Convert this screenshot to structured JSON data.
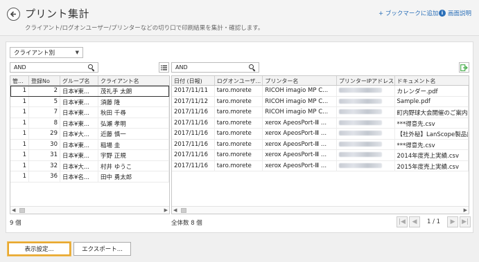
{
  "header": {
    "title": "プリント集計",
    "subtitle": "クライアント/ログオンユーザー/プリンターなどの切り口で印刷結果を集計・確認します。",
    "bookmark_label": "+ ブックマークに追加",
    "help_label": "画面説明"
  },
  "filter": {
    "selected": "クライアント別"
  },
  "left_search": {
    "value": "AND"
  },
  "right_search": {
    "value": "AND"
  },
  "left_table": {
    "columns": [
      "管...",
      "登録No",
      "グループ名",
      "クライアント名"
    ],
    "rows": [
      [
        "1",
        "2",
        "日本¥東...",
        "茂礼手 太朗"
      ],
      [
        "1",
        "5",
        "日本¥東...",
        "須藤 隆"
      ],
      [
        "1",
        "7",
        "日本¥東...",
        "秋田 千尋"
      ],
      [
        "1",
        "8",
        "日本¥東...",
        "弘瀬 孝明"
      ],
      [
        "1",
        "29",
        "日本¥大...",
        "近藤 慎一"
      ],
      [
        "1",
        "30",
        "日本¥東...",
        "稲場 圭"
      ],
      [
        "1",
        "31",
        "日本¥東...",
        "宇野 正規"
      ],
      [
        "1",
        "32",
        "日本¥大...",
        "村井 ゆうこ"
      ],
      [
        "1",
        "36",
        "日本¥名...",
        "田中 勇太郎"
      ]
    ],
    "count": "9 個"
  },
  "right_table": {
    "columns": [
      "日付 (日報)",
      "ログオンユーザ...",
      "プリンター名",
      "プリンターIPアドレス",
      "ドキュメント名"
    ],
    "rows": [
      [
        "2017/11/11",
        "taro.morete",
        "RICOH imagio MP C...",
        "",
        "カレンダー.pdf"
      ],
      [
        "2017/11/12",
        "taro.morete",
        "RICOH imagio MP C...",
        "",
        "Sample.pdf"
      ],
      [
        "2017/11/16",
        "taro.morete",
        "RICOH imagio MP C...",
        "",
        "町内野球大会開催のご案内"
      ],
      [
        "2017/11/16",
        "taro.morete",
        "xerox ApeosPort-Ⅲ ...",
        "",
        "***得意先.csv"
      ],
      [
        "2017/11/16",
        "taro.morete",
        "xerox ApeosPort-Ⅲ ...",
        "",
        "【社外秘】LanScope製品設"
      ],
      [
        "2017/11/16",
        "taro.morete",
        "xerox ApeosPort-Ⅲ ...",
        "",
        "***得意先.csv"
      ],
      [
        "2017/11/16",
        "taro.morete",
        "xerox ApeosPort-Ⅲ ...",
        "",
        "2014年度売上実績.csv"
      ],
      [
        "2017/11/16",
        "taro.morete",
        "xerox ApeosPort-Ⅲ ...",
        "",
        "2015年度売上実績.csv"
      ]
    ],
    "count": "全体数 8 個"
  },
  "pager": {
    "info": "1 / 1"
  },
  "buttons": {
    "display_settings": "表示設定...",
    "export": "エクスポート..."
  },
  "colors": {
    "link": "#2a6fb8",
    "highlight_border": "#e8a830",
    "export_icon": "#4caf50"
  }
}
